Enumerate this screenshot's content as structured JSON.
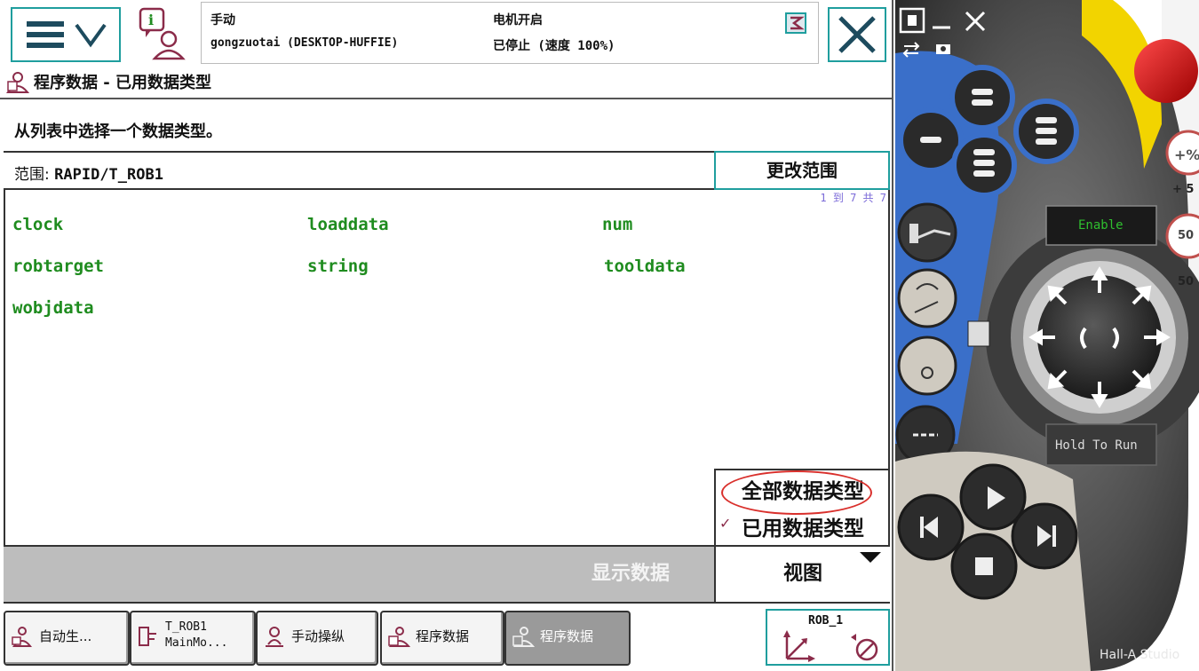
{
  "status": {
    "mode": "手动",
    "station": "gongzuotai (DESKTOP-HUFFIE)",
    "motor": "电机开启",
    "state": "已停止 (速度 100%)"
  },
  "app": {
    "title": "程序数据 - 已用数据类型",
    "instruction": "从列表中选择一个数据类型。"
  },
  "scope": {
    "label": "范围:",
    "value": "RAPID/T_ROB1",
    "change_button": "更改范围"
  },
  "list": {
    "count": "1 到 7 共 7",
    "types": [
      "clock",
      "loaddata",
      "num",
      "robtarget",
      "string",
      "tooldata",
      "wobjdata"
    ]
  },
  "view_menu": {
    "all_types": "全部数据类型",
    "used_types": "已用数据类型",
    "check": "✓"
  },
  "actions": {
    "show_data": "显示数据",
    "view": "视图"
  },
  "taskbar": [
    {
      "label": "自动生..."
    },
    {
      "line1": "T_ROB1",
      "line2": "MainMo..."
    },
    {
      "label": "手动操纵"
    },
    {
      "label": "程序数据"
    },
    {
      "label": "程序数据"
    }
  ],
  "robot": {
    "label": "ROB_1"
  },
  "pendant": {
    "enable": "Enable",
    "hold_to_run": "Hold To Run",
    "speed_plus": "+ 5",
    "speed_50": "50",
    "speed_50_2": "50"
  },
  "watermark": "Hall-A Studio",
  "colors": {
    "accent": "#1f9e9e",
    "datatype": "#1f8c1f",
    "pendant_blue": "#3a6fc9",
    "stop_red": "#d81818",
    "yellow": "#f2d400"
  }
}
